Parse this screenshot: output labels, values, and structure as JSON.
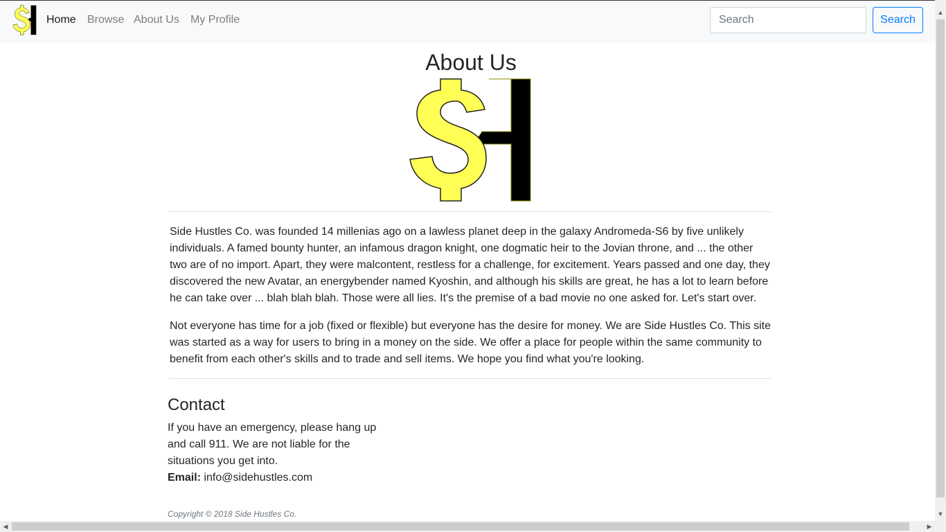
{
  "nav": {
    "items": [
      {
        "label": "Home",
        "active": true
      },
      {
        "label": "Browse",
        "active": false
      },
      {
        "label": "About Us",
        "active": false
      },
      {
        "label": "My Profile",
        "active": false
      }
    ],
    "search": {
      "placeholder": "Search",
      "value": "",
      "button_label": "Search"
    }
  },
  "logo": {
    "icon": "side-hustles-logo-icon",
    "colors": {
      "dollar": "#ffff55",
      "h": "#000000"
    }
  },
  "main": {
    "title": "About Us",
    "paragraphs": [
      "Side Hustles Co. was founded 14 millenias ago on a lawless planet deep in the galaxy Andromeda-S6 by five unlikely individuals. A famed bounty hunter, an infamous dragon knight, one dogmatic heir to the Jovian throne, and ... the other two are of no import. Apart, they were malcontent, restless for a challenge, for excitement. Years passed and one day, they discovered the new Avatar, an energybender named Kyoshin, and although his skills are great, he has a lot to learn before he can take over ... blah blah blah. Those were all lies. It's the premise of a bad movie no one asked for. Let's start over.",
      "Not everyone has time for a job (fixed or flexible) but everyone has the desire for money. We are Side Hustles Co. This site was started as a way for users to bring in a money on the side. We offer a place for people within the same community to benefit from each other's skills and to trade and sell items. We hope you find what you're looking."
    ]
  },
  "contact": {
    "title": "Contact",
    "text": "If you have an emergency, please hang up and call 911. We are not liable for the situations you get into.",
    "email_label": "Email:",
    "email": "info@sidehustles.com"
  },
  "footer": {
    "copyright": "Copyright © 2018 Side Hustles Co."
  },
  "theme": {
    "navbar_bg": "#f8f9fa",
    "link_blue": "#007bff",
    "text": "#212529"
  }
}
